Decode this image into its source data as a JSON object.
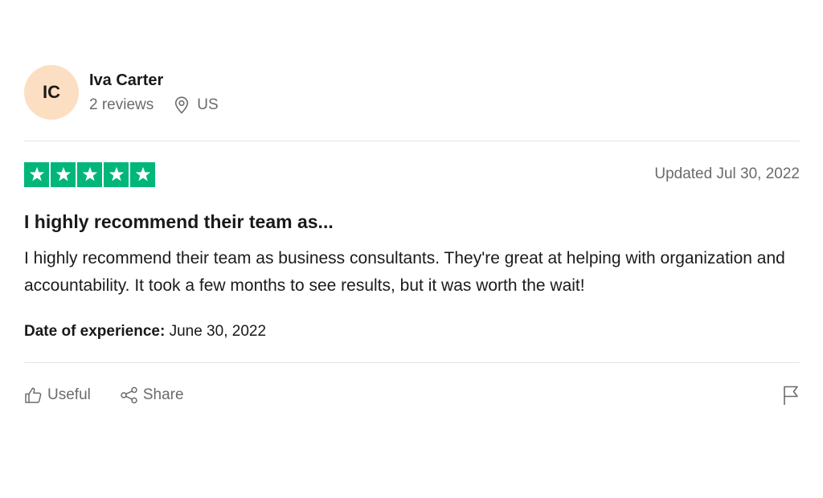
{
  "reviewer": {
    "initials": "IC",
    "name": "Iva Carter",
    "reviews_count": "2 reviews",
    "location": "US",
    "avatar_color": "#fcdec2"
  },
  "review": {
    "rating": 5,
    "max_rating": 5,
    "star_color": "#00b67a",
    "updated": "Updated Jul 30, 2022",
    "title": "I highly recommend their team as...",
    "body": "I highly recommend their team as business consultants. They're great at helping with organization and accountability. It took a few months to see results, but it was worth the wait!",
    "date_label": "Date of experience:",
    "date_value": "June 30, 2022"
  },
  "actions": {
    "useful_label": "Useful",
    "share_label": "Share"
  },
  "icons": {
    "location": "location-pin-icon",
    "useful": "thumbs-up-icon",
    "share": "share-icon",
    "flag": "flag-icon",
    "star": "star-icon"
  }
}
